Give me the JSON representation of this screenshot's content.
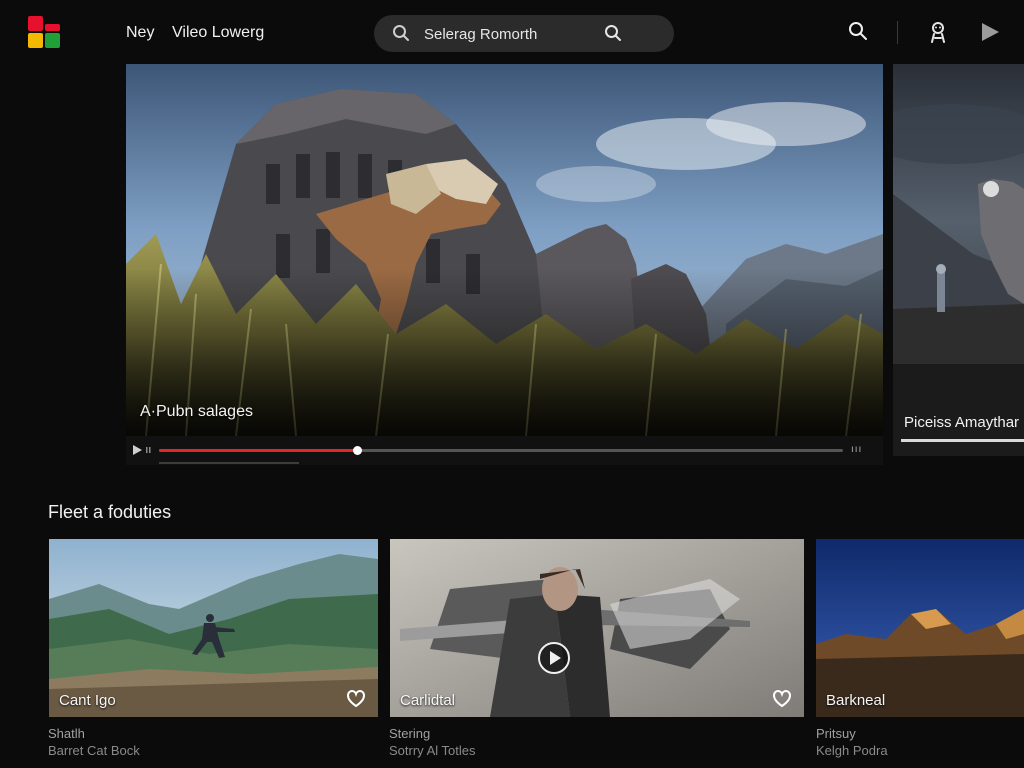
{
  "app": {
    "colors": {
      "accent": "#e02828",
      "logo_red": "#e8112d",
      "logo_yellow": "#f5b800",
      "logo_green": "#21a038"
    }
  },
  "nav": {
    "links": [
      "Ney",
      "Vileo Lowerg"
    ]
  },
  "search": {
    "value": "Selerag Romorth",
    "icon_left": "search-icon",
    "icon_right": "search-icon"
  },
  "top_icons": [
    "search-icon",
    "account-icon",
    "play-icon"
  ],
  "hero": {
    "title": "A·Pubn salages",
    "progress": 0.29,
    "controls_right": "ııı"
  },
  "side_card": {
    "title": "Piceiss Amaythar"
  },
  "row": {
    "title": "Fleet a foduties",
    "cards": [
      {
        "title": "Cant Igo",
        "meta1": "Shatlh",
        "meta2": "Barret Cat Bock",
        "icon": "heart-icon"
      },
      {
        "title": "Carlidtal",
        "meta1": "Stering",
        "meta2": "Sotrry Al Totles",
        "icon": "heart-icon",
        "overlay_icon": "play-circle-icon"
      },
      {
        "title": "Barkneal",
        "meta1": "Pritsuy",
        "meta2": "Kelgh Podra"
      }
    ]
  }
}
